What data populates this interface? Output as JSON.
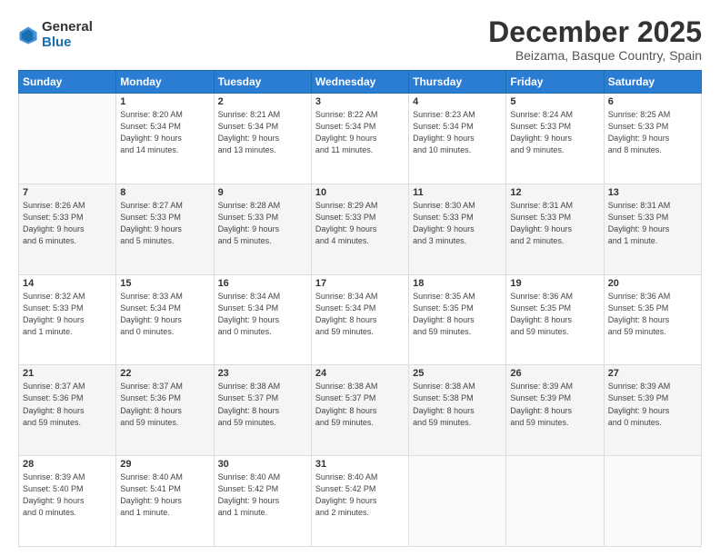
{
  "logo": {
    "general": "General",
    "blue": "Blue"
  },
  "title": "December 2025",
  "location": "Beizama, Basque Country, Spain",
  "days_header": [
    "Sunday",
    "Monday",
    "Tuesday",
    "Wednesday",
    "Thursday",
    "Friday",
    "Saturday"
  ],
  "weeks": [
    [
      {
        "day": "",
        "info": ""
      },
      {
        "day": "1",
        "info": "Sunrise: 8:20 AM\nSunset: 5:34 PM\nDaylight: 9 hours\nand 14 minutes."
      },
      {
        "day": "2",
        "info": "Sunrise: 8:21 AM\nSunset: 5:34 PM\nDaylight: 9 hours\nand 13 minutes."
      },
      {
        "day": "3",
        "info": "Sunrise: 8:22 AM\nSunset: 5:34 PM\nDaylight: 9 hours\nand 11 minutes."
      },
      {
        "day": "4",
        "info": "Sunrise: 8:23 AM\nSunset: 5:34 PM\nDaylight: 9 hours\nand 10 minutes."
      },
      {
        "day": "5",
        "info": "Sunrise: 8:24 AM\nSunset: 5:33 PM\nDaylight: 9 hours\nand 9 minutes."
      },
      {
        "day": "6",
        "info": "Sunrise: 8:25 AM\nSunset: 5:33 PM\nDaylight: 9 hours\nand 8 minutes."
      }
    ],
    [
      {
        "day": "7",
        "info": "Sunrise: 8:26 AM\nSunset: 5:33 PM\nDaylight: 9 hours\nand 6 minutes."
      },
      {
        "day": "8",
        "info": "Sunrise: 8:27 AM\nSunset: 5:33 PM\nDaylight: 9 hours\nand 5 minutes."
      },
      {
        "day": "9",
        "info": "Sunrise: 8:28 AM\nSunset: 5:33 PM\nDaylight: 9 hours\nand 5 minutes."
      },
      {
        "day": "10",
        "info": "Sunrise: 8:29 AM\nSunset: 5:33 PM\nDaylight: 9 hours\nand 4 minutes."
      },
      {
        "day": "11",
        "info": "Sunrise: 8:30 AM\nSunset: 5:33 PM\nDaylight: 9 hours\nand 3 minutes."
      },
      {
        "day": "12",
        "info": "Sunrise: 8:31 AM\nSunset: 5:33 PM\nDaylight: 9 hours\nand 2 minutes."
      },
      {
        "day": "13",
        "info": "Sunrise: 8:31 AM\nSunset: 5:33 PM\nDaylight: 9 hours\nand 1 minute."
      }
    ],
    [
      {
        "day": "14",
        "info": "Sunrise: 8:32 AM\nSunset: 5:33 PM\nDaylight: 9 hours\nand 1 minute."
      },
      {
        "day": "15",
        "info": "Sunrise: 8:33 AM\nSunset: 5:34 PM\nDaylight: 9 hours\nand 0 minutes."
      },
      {
        "day": "16",
        "info": "Sunrise: 8:34 AM\nSunset: 5:34 PM\nDaylight: 9 hours\nand 0 minutes."
      },
      {
        "day": "17",
        "info": "Sunrise: 8:34 AM\nSunset: 5:34 PM\nDaylight: 8 hours\nand 59 minutes."
      },
      {
        "day": "18",
        "info": "Sunrise: 8:35 AM\nSunset: 5:35 PM\nDaylight: 8 hours\nand 59 minutes."
      },
      {
        "day": "19",
        "info": "Sunrise: 8:36 AM\nSunset: 5:35 PM\nDaylight: 8 hours\nand 59 minutes."
      },
      {
        "day": "20",
        "info": "Sunrise: 8:36 AM\nSunset: 5:35 PM\nDaylight: 8 hours\nand 59 minutes."
      }
    ],
    [
      {
        "day": "21",
        "info": "Sunrise: 8:37 AM\nSunset: 5:36 PM\nDaylight: 8 hours\nand 59 minutes."
      },
      {
        "day": "22",
        "info": "Sunrise: 8:37 AM\nSunset: 5:36 PM\nDaylight: 8 hours\nand 59 minutes."
      },
      {
        "day": "23",
        "info": "Sunrise: 8:38 AM\nSunset: 5:37 PM\nDaylight: 8 hours\nand 59 minutes."
      },
      {
        "day": "24",
        "info": "Sunrise: 8:38 AM\nSunset: 5:37 PM\nDaylight: 8 hours\nand 59 minutes."
      },
      {
        "day": "25",
        "info": "Sunrise: 8:38 AM\nSunset: 5:38 PM\nDaylight: 8 hours\nand 59 minutes."
      },
      {
        "day": "26",
        "info": "Sunrise: 8:39 AM\nSunset: 5:39 PM\nDaylight: 8 hours\nand 59 minutes."
      },
      {
        "day": "27",
        "info": "Sunrise: 8:39 AM\nSunset: 5:39 PM\nDaylight: 9 hours\nand 0 minutes."
      }
    ],
    [
      {
        "day": "28",
        "info": "Sunrise: 8:39 AM\nSunset: 5:40 PM\nDaylight: 9 hours\nand 0 minutes."
      },
      {
        "day": "29",
        "info": "Sunrise: 8:40 AM\nSunset: 5:41 PM\nDaylight: 9 hours\nand 1 minute."
      },
      {
        "day": "30",
        "info": "Sunrise: 8:40 AM\nSunset: 5:42 PM\nDaylight: 9 hours\nand 1 minute."
      },
      {
        "day": "31",
        "info": "Sunrise: 8:40 AM\nSunset: 5:42 PM\nDaylight: 9 hours\nand 2 minutes."
      },
      {
        "day": "",
        "info": ""
      },
      {
        "day": "",
        "info": ""
      },
      {
        "day": "",
        "info": ""
      }
    ]
  ]
}
